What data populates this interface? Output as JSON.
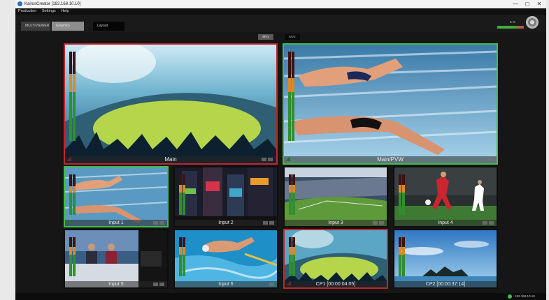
{
  "window": {
    "title": "KairosCreator [192.168.10.10]",
    "controls": {
      "minimize": "—",
      "maximize": "◻",
      "close": "✕"
    }
  },
  "menu": {
    "items": [
      "Production",
      "Settings",
      "Help"
    ]
  },
  "toolbar": {
    "buttons": [
      {
        "label": "MULTIVIEWER",
        "state": "normal"
      },
      {
        "label": "Graphics",
        "state": "selected"
      },
      {
        "label": "Layout",
        "state": "dark"
      }
    ],
    "level_percent": "0 %"
  },
  "multiviewer_tabs": [
    {
      "label": "MV1",
      "active": true
    },
    {
      "label": "MV2",
      "active": false
    }
  ],
  "tiles": [
    {
      "label": "Main",
      "tally": "program",
      "scene": "stadium"
    },
    {
      "label": "Main/PVW",
      "tally": "preview",
      "scene": "swim-pool"
    },
    {
      "label": "Input 1",
      "tally": "preview",
      "scene": "swim-pool"
    },
    {
      "label": "Input 2",
      "tally": "none",
      "scene": "city-night"
    },
    {
      "label": "Input 3",
      "tally": "none",
      "scene": "stadium-day"
    },
    {
      "label": "Input 4",
      "tally": "none",
      "scene": "soccer"
    },
    {
      "label": "Input 5",
      "tally": "none",
      "scene": "news-studio"
    },
    {
      "label": "Input 6",
      "tally": "none",
      "scene": "swimmer"
    },
    {
      "label": "CP1  [00:00:04:05]",
      "tally": "program",
      "scene": "stadium"
    },
    {
      "label": "CP2  [00:00:37:14]",
      "tally": "none",
      "scene": "sky-island"
    }
  ],
  "status": {
    "ip": "192.168.10.10",
    "connection": "connected"
  },
  "colors": {
    "program_tally": "#c1262b",
    "preview_tally": "#3fbf46",
    "background": "#161616"
  }
}
